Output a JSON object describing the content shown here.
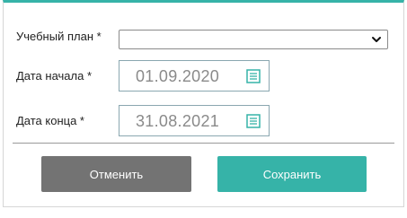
{
  "form": {
    "plan_label": "Учебный план *",
    "plan_value": "",
    "start_label": "Дата начала *",
    "start_value": "01.09.2020",
    "end_label": "Дата конца *",
    "end_value": "31.08.2021"
  },
  "actions": {
    "cancel_label": "Отменить",
    "save_label": "Сохранить"
  },
  "icons": {
    "select_chevron": "chevron-down-icon",
    "date_picker": "calendar-icon"
  },
  "colors": {
    "accent": "#36b3a8",
    "cancel_button": "#737373",
    "date_text": "#8a8a8a"
  }
}
